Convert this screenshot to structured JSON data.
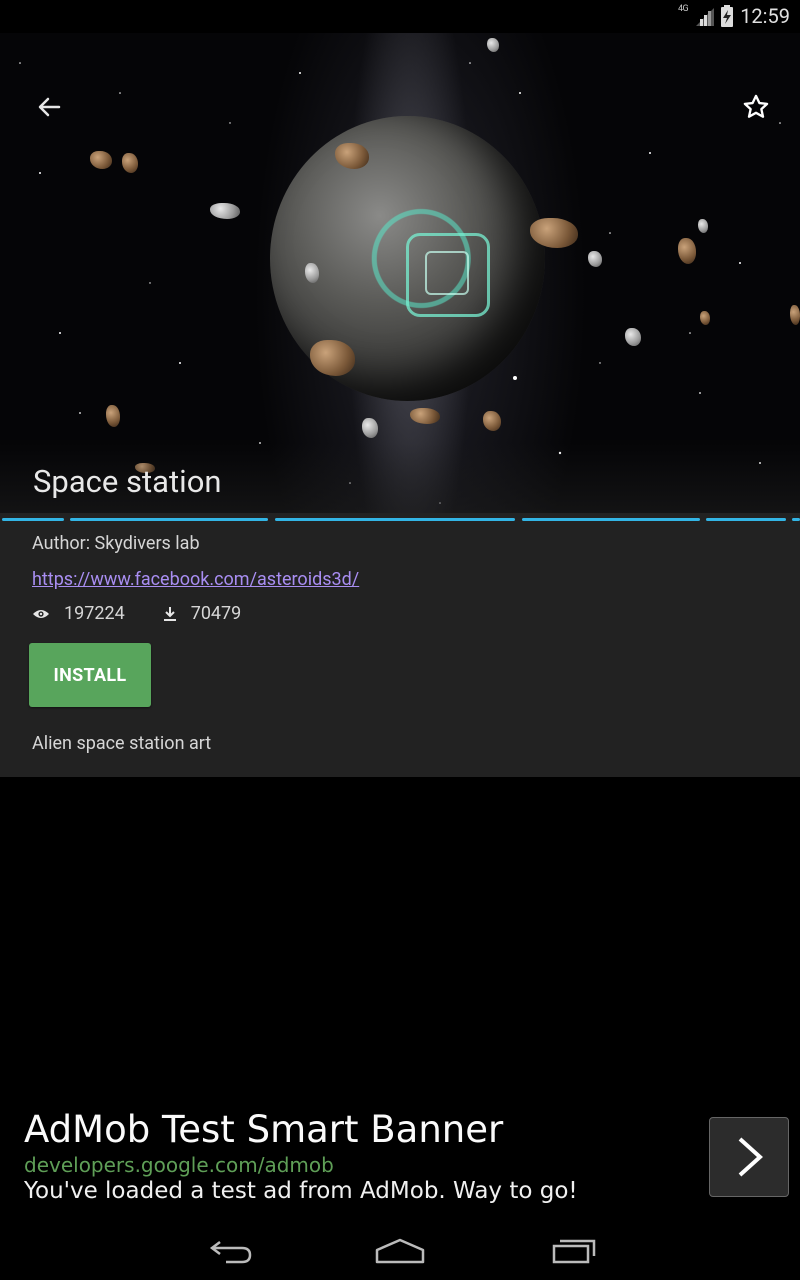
{
  "status_bar": {
    "network": "4G",
    "time": "12:59"
  },
  "hero": {
    "title": "Space station"
  },
  "info": {
    "author": "Author: Skydivers lab",
    "link": "https://www.facebook.com/asteroids3d/",
    "views": "197224",
    "downloads": "70479",
    "install_label": "INSTALL",
    "description": "Alien space station art"
  },
  "ad": {
    "title": "AdMob Test Smart Banner",
    "url": "developers.google.com/admob",
    "body": "You've loaded a test ad from AdMob. Way to go!"
  },
  "colors": {
    "accent_blue": "#33b5e5",
    "install_green": "#58a55c",
    "link_purple": "#a98ef2",
    "ad_url_green": "#5f9f57"
  }
}
